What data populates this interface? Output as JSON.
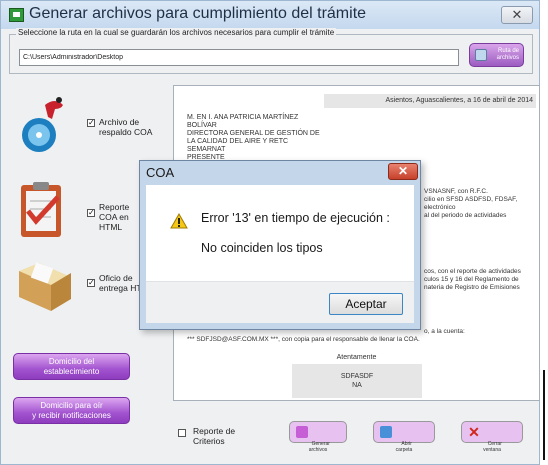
{
  "window": {
    "title": "Generar archivos para cumplimiento del trámite",
    "close_glyph": "✕"
  },
  "path_group": {
    "legend": "Seleccione la ruta en la cual se guardarán los archivos necesarios para cumplir el trámite",
    "path_value": "C:\\Users\\Administrador\\Desktop",
    "ruta_button_label": "Ruta de archivos"
  },
  "options": [
    {
      "icon": "disc-backup-icon",
      "label": "Archivo de\nrespaldo COA",
      "checked": true
    },
    {
      "icon": "clipboard-checklist-icon",
      "label": "Reporte\nCOA en\nHTML",
      "checked": true
    },
    {
      "icon": "document-folder-icon",
      "label": "Oficio de\nentrega HT",
      "checked": true
    }
  ],
  "side_buttons": [
    {
      "label": "Domicilio del\nestablecimiento"
    },
    {
      "label": "Domicilio para oír\ny recibir notificaciones"
    }
  ],
  "document": {
    "date_line": "Asientos, Aguascalientes, a 16 de abril de 2014",
    "recipient": "M. EN I. ANA PATRICIA MARTÍNEZ\nBOLÍVAR\nDIRECTORA GENERAL DE GESTIÓN DE\nLA CALIDAD DEL AIRE Y RETC\nSEMARNAT\nPRESENTE",
    "fragments_a": [
      "VSNASNF, con R.F.C.",
      "cilio en SFSD ASDFSD, FDSAF,",
      "electrónico",
      "al del periodo de actividades"
    ],
    "fragments_b": [
      "cos, con el reporte de actividades",
      "culos 15 y 16 del Reglamento de",
      "nateria de Registro de Emisiones"
    ],
    "email_line": "o, a la cuenta:",
    "email_full": "*** SDFJSD@ASF.COM.MX ***, con copia para el responsable de llenar la COA.",
    "atentamente": "Atentamente",
    "signature": "SDFASDF\nNA"
  },
  "bottom": {
    "criterios_label": "Reporte de\nCriterios",
    "criterios_checked": false,
    "action_buttons": [
      {
        "label": "Generar\narchivos",
        "color": "#e4a8ee"
      },
      {
        "label": "Abrir\ncarpeta",
        "color": "#e4a8ee"
      },
      {
        "label": "Cerrar\nventana",
        "color": "#e4a8ee"
      }
    ]
  },
  "dialog": {
    "title": "COA",
    "close_glyph": "✕",
    "message_line1": "Error '13' en tiempo de ejecución :",
    "message_line2": "No coinciden los tipos",
    "accept_label": "Aceptar"
  },
  "colors": {
    "accent_purple": "#a253cf",
    "titlebar": "#c4d8ee",
    "dialog_close": "#c6412b"
  }
}
